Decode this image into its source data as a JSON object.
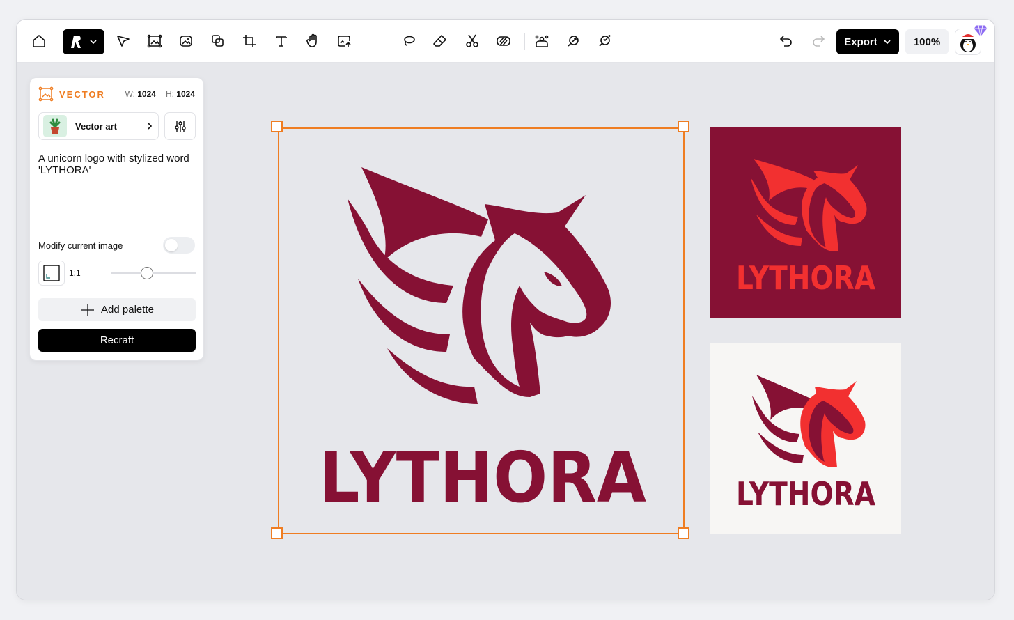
{
  "toolbar": {
    "export_label": "Export",
    "zoom_label": "100%"
  },
  "panel": {
    "mode_label": "VECTOR",
    "width_label": "W:",
    "width_value": "1024",
    "height_label": "H:",
    "height_value": "1024",
    "style_name": "Vector art",
    "prompt_text": "A unicorn logo with stylized word 'LYTHORA'",
    "modify_label": "Modify current image",
    "modify_enabled": false,
    "aspect_label": "1:1",
    "slider_value": 0.4,
    "add_palette_label": "Add palette",
    "recraft_label": "Recraft"
  },
  "canvas": {
    "brand_word": "LYTHORA",
    "selection_color": "#ef7d22"
  },
  "colors": {
    "maroon": "#861134",
    "red": "#f23030",
    "canvas_bg": "#e6e7eb",
    "light_bg": "#f7f6f4"
  },
  "icons": [
    "home-icon",
    "recraft-logo-icon",
    "select-arrow-icon",
    "frame-image-icon",
    "image-icon",
    "layers-icon",
    "crop-icon",
    "text-icon",
    "hand-icon",
    "upload-image-icon",
    "lasso-icon",
    "eraser-icon",
    "scissors-icon",
    "remove-bg-icon",
    "group-icon",
    "vectorize-icon",
    "magic-icon",
    "undo-icon",
    "redo-icon",
    "chevron-down-icon",
    "plus-icon",
    "sliders-icon",
    "aspect-ratio-icon",
    "gem-icon"
  ]
}
